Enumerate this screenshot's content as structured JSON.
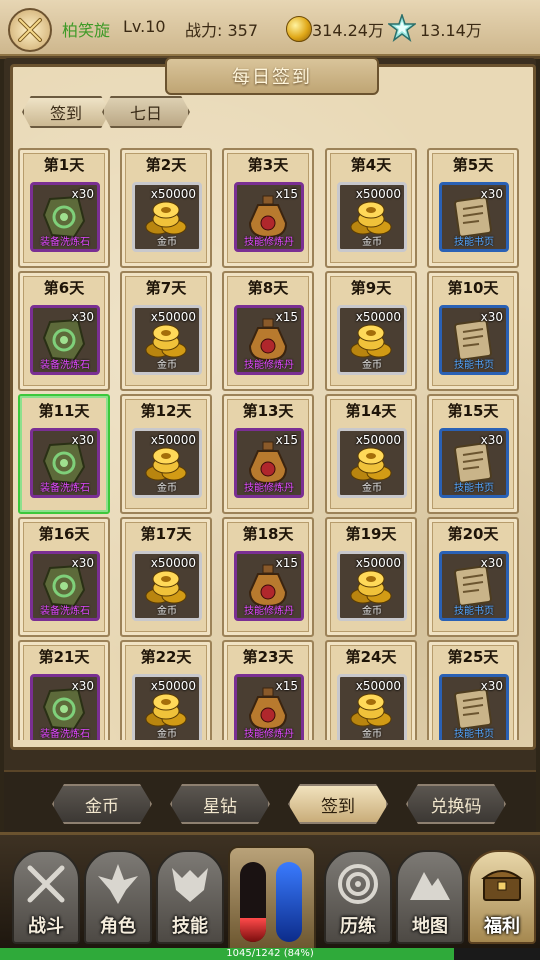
{
  "player": {
    "name": "柏笑旋",
    "level": "Lv.10",
    "power": "战力: 357",
    "gold": "314.24万",
    "diamonds": "13.14万"
  },
  "panel": {
    "title": "每日签到",
    "tabs": [
      "签到",
      "七日"
    ]
  },
  "days": [
    {
      "day": "第1天",
      "qty": "x30",
      "name": "装备洗炼石",
      "rarity": "purple",
      "icon": "stone-icon"
    },
    {
      "day": "第2天",
      "qty": "x50000",
      "name": "金币",
      "rarity": "gray",
      "icon": "gold-coins-icon"
    },
    {
      "day": "第3天",
      "qty": "x15",
      "name": "技能修炼丹",
      "rarity": "purple",
      "icon": "potion-bag-icon"
    },
    {
      "day": "第4天",
      "qty": "x50000",
      "name": "金币",
      "rarity": "gray",
      "icon": "gold-coins-icon"
    },
    {
      "day": "第5天",
      "qty": "x30",
      "name": "技能书页",
      "rarity": "blue",
      "icon": "scroll-icon"
    },
    {
      "day": "第6天",
      "qty": "x30",
      "name": "装备洗炼石",
      "rarity": "purple",
      "icon": "stone-icon"
    },
    {
      "day": "第7天",
      "qty": "x50000",
      "name": "金币",
      "rarity": "gray",
      "icon": "gold-coins-icon"
    },
    {
      "day": "第8天",
      "qty": "x15",
      "name": "技能修炼丹",
      "rarity": "purple",
      "icon": "potion-bag-icon"
    },
    {
      "day": "第9天",
      "qty": "x50000",
      "name": "金币",
      "rarity": "gray",
      "icon": "gold-coins-icon"
    },
    {
      "day": "第10天",
      "qty": "x30",
      "name": "技能书页",
      "rarity": "blue",
      "icon": "scroll-icon"
    },
    {
      "day": "第11天",
      "qty": "x30",
      "name": "装备洗炼石",
      "rarity": "purple",
      "icon": "stone-icon",
      "today": true
    },
    {
      "day": "第12天",
      "qty": "x50000",
      "name": "金币",
      "rarity": "gray",
      "icon": "gold-coins-icon"
    },
    {
      "day": "第13天",
      "qty": "x15",
      "name": "技能修炼丹",
      "rarity": "purple",
      "icon": "potion-bag-icon"
    },
    {
      "day": "第14天",
      "qty": "x50000",
      "name": "金币",
      "rarity": "gray",
      "icon": "gold-coins-icon"
    },
    {
      "day": "第15天",
      "qty": "x30",
      "name": "技能书页",
      "rarity": "blue",
      "icon": "scroll-icon"
    },
    {
      "day": "第16天",
      "qty": "x30",
      "name": "装备洗炼石",
      "rarity": "purple",
      "icon": "stone-icon"
    },
    {
      "day": "第17天",
      "qty": "x50000",
      "name": "金币",
      "rarity": "gray",
      "icon": "gold-coins-icon"
    },
    {
      "day": "第18天",
      "qty": "x15",
      "name": "技能修炼丹",
      "rarity": "purple",
      "icon": "potion-bag-icon"
    },
    {
      "day": "第19天",
      "qty": "x50000",
      "name": "金币",
      "rarity": "gray",
      "icon": "gold-coins-icon"
    },
    {
      "day": "第20天",
      "qty": "x30",
      "name": "技能书页",
      "rarity": "blue",
      "icon": "scroll-icon"
    },
    {
      "day": "第21天",
      "qty": "x30",
      "name": "装备洗炼石",
      "rarity": "purple",
      "icon": "stone-icon"
    },
    {
      "day": "第22天",
      "qty": "x50000",
      "name": "金币",
      "rarity": "gray",
      "icon": "gold-coins-icon"
    },
    {
      "day": "第23天",
      "qty": "x15",
      "name": "技能修炼丹",
      "rarity": "purple",
      "icon": "potion-bag-icon"
    },
    {
      "day": "第24天",
      "qty": "x50000",
      "name": "金币",
      "rarity": "gray",
      "icon": "gold-coins-icon"
    },
    {
      "day": "第25天",
      "qty": "x30",
      "name": "技能书页",
      "rarity": "blue",
      "icon": "scroll-icon"
    }
  ],
  "subnav": {
    "items": [
      "金币",
      "星钻",
      "签到",
      "兑换码"
    ],
    "active_index": 2
  },
  "bottomnav": {
    "left": [
      "战斗",
      "角色",
      "技能"
    ],
    "right": [
      "历练",
      "地图",
      "福利"
    ],
    "active": "福利"
  },
  "orbs": {
    "hp_fraction": 0.3
  },
  "exp": {
    "text": "1045/1242 (84%)",
    "fraction": 0.84
  },
  "colors": {
    "name_green": "#3f9a27",
    "today_border": "#3cc83c",
    "rarity_purple": "#7a2f93",
    "rarity_blue": "#2a61b5",
    "rarity_gray": "#c8c8cc"
  }
}
